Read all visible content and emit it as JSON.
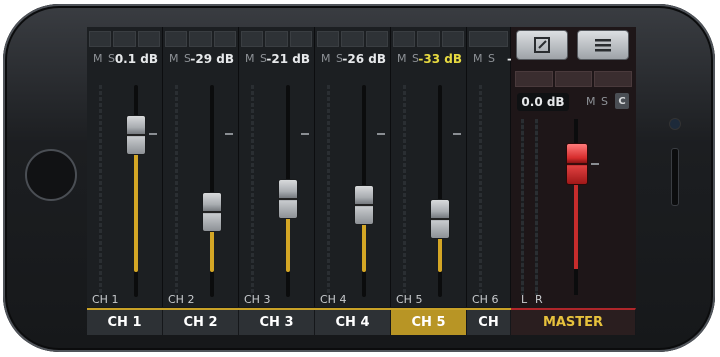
{
  "channels": [
    {
      "label": "CH 1",
      "tab": "CH 1",
      "mute": "M",
      "solo": "S",
      "db": "0.1 dB",
      "highlight": false,
      "active": false
    },
    {
      "label": "CH 2",
      "tab": "CH 2",
      "mute": "M",
      "solo": "S",
      "db": "-29 dB",
      "highlight": false,
      "active": false
    },
    {
      "label": "CH 3",
      "tab": "CH 3",
      "mute": "M",
      "solo": "S",
      "db": "-21 dB",
      "highlight": false,
      "active": false
    },
    {
      "label": "CH 4",
      "tab": "CH 4",
      "mute": "M",
      "solo": "S",
      "db": "-26 dB",
      "highlight": false,
      "active": false
    },
    {
      "label": "CH 5",
      "tab": "CH 5",
      "mute": "M",
      "solo": "S",
      "db": "-33 dB",
      "highlight": true,
      "active": true
    },
    {
      "label": "CH 6",
      "tab": "CH",
      "mute": "M",
      "solo": "S",
      "db": "-",
      "highlight": false,
      "active": false
    }
  ],
  "master": {
    "db": "0.0 dB",
    "mute": "M",
    "solo": "S",
    "c": "C",
    "left": "L",
    "right": "R",
    "tab": "MASTER",
    "edit_icon": "edit-icon",
    "menu_icon": "menu-icon"
  },
  "colors": {
    "accent": "#c9a227",
    "master_red": "#d62c2c",
    "highlight_db": "#e6d940"
  }
}
